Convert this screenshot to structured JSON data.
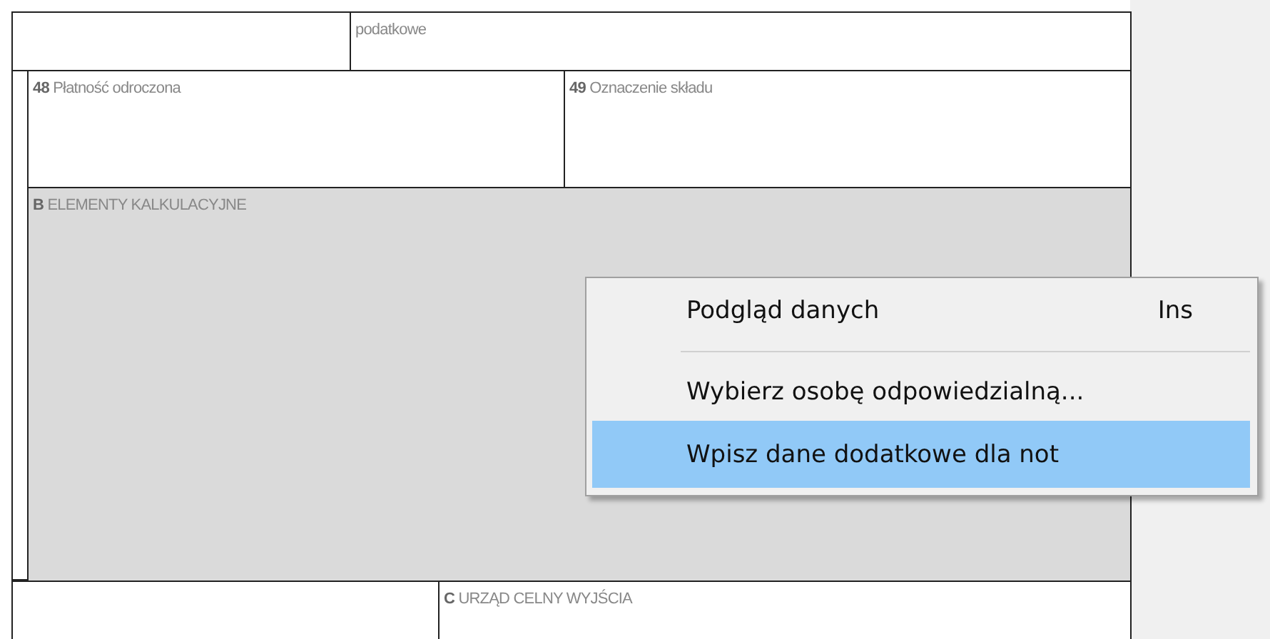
{
  "form": {
    "top_row": [
      {
        "label": "podatkowe"
      }
    ],
    "fields": [
      {
        "label": "**48** Płatność odroczona"
      },
      {
        "label": "**49** Oznaczenie składu"
      }
    ],
    "section_b": {
      "label": "**B** ELEMENTY KALKULACYJNE"
    },
    "bottom_row": [
      {
        "label": "**C** URZĄD CELNY WYJŚCIA"
      }
    ]
  },
  "context_menu": {
    "items": [
      {
        "kind": "item",
        "label": "Podgląd danych",
        "shortcut": "Ins",
        "selected": false
      },
      {
        "kind": "separator"
      },
      {
        "kind": "item",
        "label": "Wybierz osobę odpowiedzialną...",
        "selected": false
      },
      {
        "kind": "item",
        "label": "Wpisz dane dodatkowe dla not",
        "selected": true
      }
    ]
  }
}
